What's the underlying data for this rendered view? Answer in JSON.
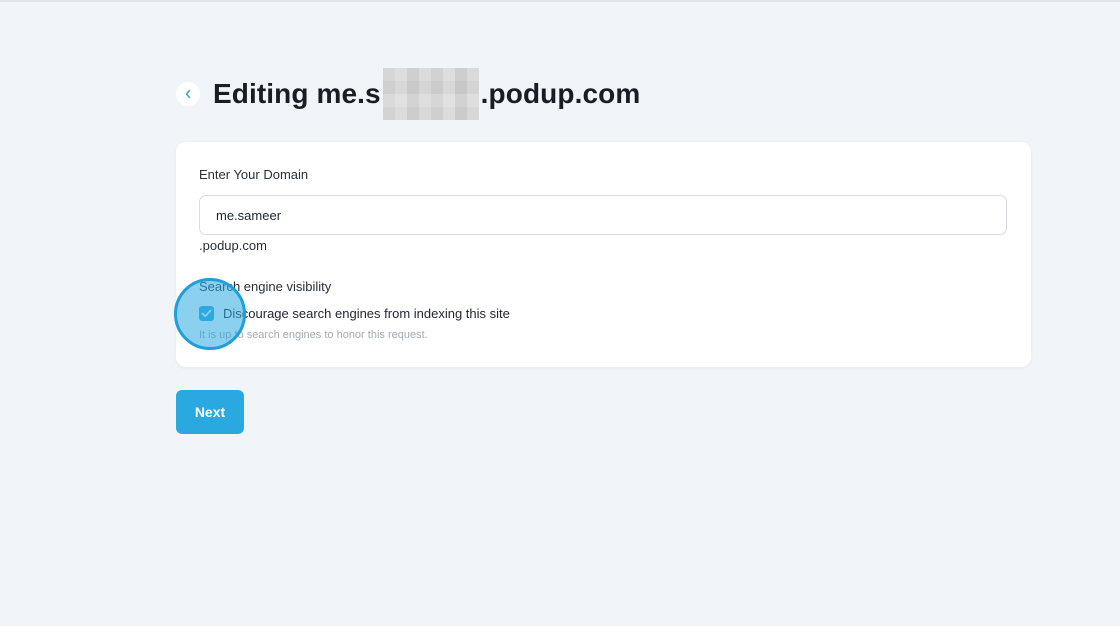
{
  "header": {
    "title_prefix": "Editing me.s",
    "title_suffix": ".podup.com",
    "back_icon": "chevron-left-icon"
  },
  "form": {
    "domain_label": "Enter Your Domain",
    "domain_value": "me.sameer",
    "domain_suffix": ".podup.com",
    "visibility_label": "Search engine visibility",
    "checkbox_label": "Discourage search engines from indexing this site",
    "checkbox_checked": true,
    "helper_text": "It is up to search engines to honor this request."
  },
  "actions": {
    "next_label": "Next"
  },
  "colors": {
    "accent": "#2aa8e0",
    "background": "#f1f5f9",
    "card": "#ffffff"
  }
}
